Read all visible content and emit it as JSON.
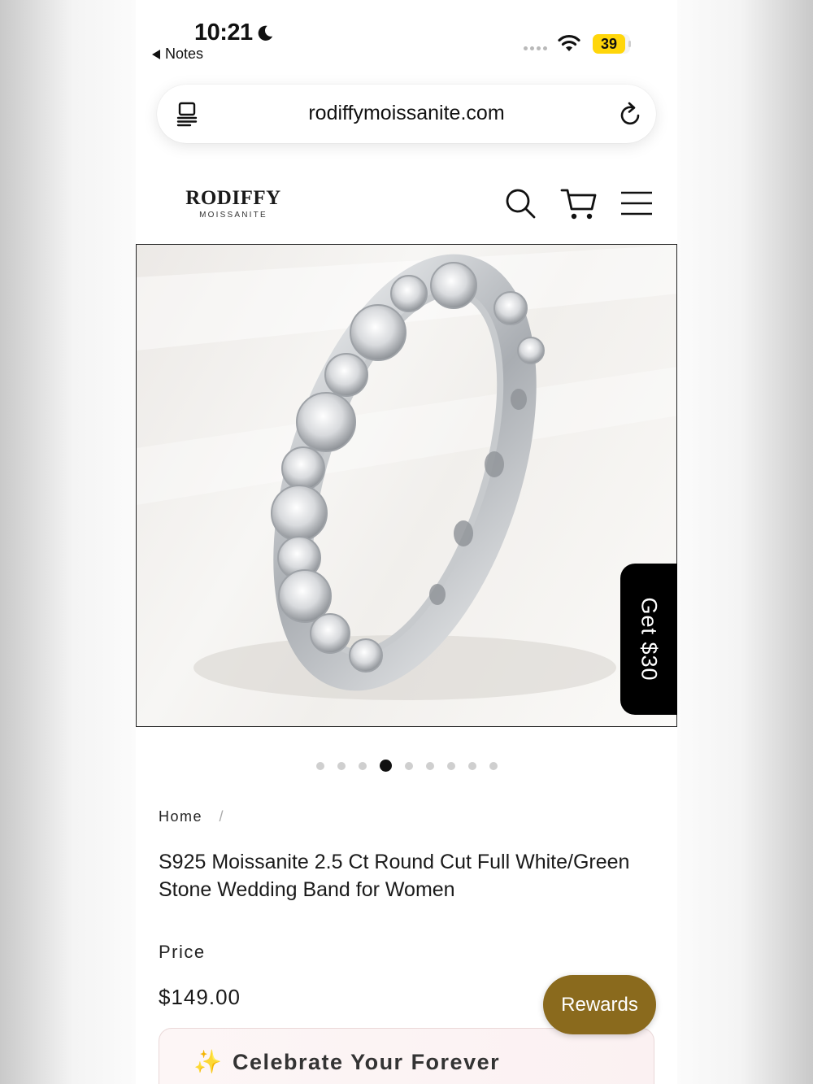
{
  "status_bar": {
    "time": "10:21",
    "back_label": "Notes",
    "battery_level": "39",
    "battery_color": "#ffd60a"
  },
  "browser": {
    "url": "rodiffymoissanite.com",
    "reader_icon": "reader-icon",
    "reload_icon": "reload-icon"
  },
  "header": {
    "logo_main": "RODIFFY",
    "logo_sub": "MOISSANITE",
    "search_icon": "search-icon",
    "cart_icon": "cart-icon",
    "menu_icon": "menu-icon"
  },
  "gallery": {
    "image_alt": "Moissanite eternity ring",
    "slide_count": 9,
    "active_slide": 4,
    "promo_tab": "Get $30"
  },
  "product": {
    "breadcrumb_home": "Home",
    "breadcrumb_sep": "/",
    "title": "S925 Moissanite 2.5 Ct Round Cut Full White/Green Stone Wedding Band for Women",
    "price_label": "Price",
    "price": "$149.00"
  },
  "rewards_button": {
    "label": "Rewards",
    "color": "#8a6a1d"
  },
  "promo_banner": {
    "icon": "sparkles-icon",
    "text": "Celebrate Your Forever"
  }
}
